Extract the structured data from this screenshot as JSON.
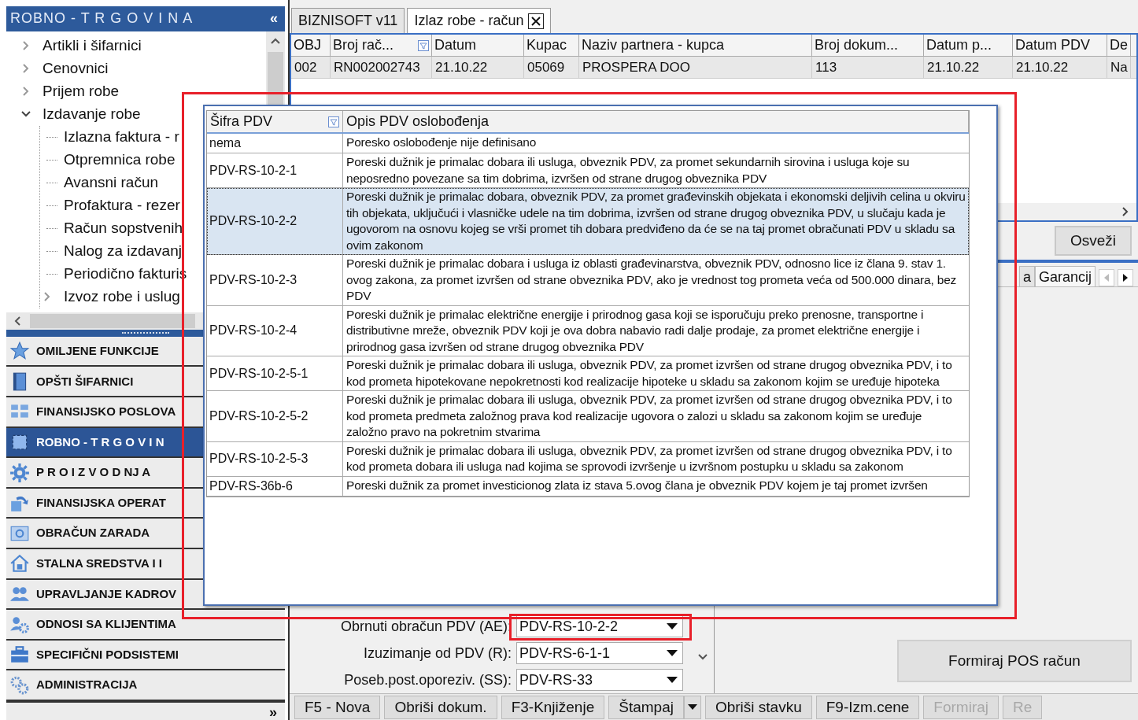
{
  "sidebar": {
    "title": "ROBNO - T R G O V I N A",
    "collapse_glyph": "«",
    "tree": [
      {
        "label": "Artikli i šifarnici",
        "expanded": false
      },
      {
        "label": "Cenovnici",
        "expanded": false
      },
      {
        "label": "Prijem robe",
        "expanded": false
      },
      {
        "label": "Izdavanje robe",
        "expanded": true,
        "children": [
          {
            "label": "Izlazna faktura - r"
          },
          {
            "label": "Otpremnica robe"
          },
          {
            "label": "Avansni račun"
          },
          {
            "label": "Profaktura - rezer"
          },
          {
            "label": "Račun sopstvenih"
          },
          {
            "label": "Nalog za izdavanj"
          },
          {
            "label": "Periodično fakturis"
          },
          {
            "label": "Izvoz robe i uslug",
            "expanded": false
          }
        ]
      }
    ],
    "nav": [
      {
        "label": "OMILJENE FUNKCIJE",
        "selected": false
      },
      {
        "label": "OPŠTI ŠIFARNICI",
        "selected": false
      },
      {
        "label": "FINANSIJSKO POSLOVA",
        "selected": false
      },
      {
        "label": "ROBNO - T R G O V I N",
        "selected": true
      },
      {
        "label": "P R O I Z V O D NJ A",
        "selected": false
      },
      {
        "label": "FINANSIJSKA OPERAT",
        "selected": false
      },
      {
        "label": "OBRAČUN ZARADA",
        "selected": false
      },
      {
        "label": "STALNA SREDSTVA I I",
        "selected": false
      },
      {
        "label": "UPRAVLJANJE KADROV",
        "selected": false
      },
      {
        "label": "ODNOSI SA KLIJENTIMA",
        "selected": false
      },
      {
        "label": "SPECIFIČNI PODSISTEMI",
        "selected": false
      },
      {
        "label": "ADMINISTRACIJA",
        "selected": false
      }
    ],
    "more_glyph": "»"
  },
  "tabs": [
    {
      "label": "BIZNISOFT v11",
      "selected": false
    },
    {
      "label": "Izlaz robe - račun",
      "selected": true
    }
  ],
  "table": {
    "columns": [
      "OBJ",
      "Broj rač...",
      "Datum",
      "Kupac",
      "Naziv partnera - kupca",
      "Broj dokum...",
      "Datum p...",
      "Datum PDV",
      "De"
    ],
    "rows": [
      {
        "cells": [
          "002",
          "RN002002743",
          "21.10.22",
          "05069",
          "PROSPERA DOO",
          "113",
          "21.10.22",
          "21.10.22",
          "Na"
        ],
        "selected": true
      }
    ]
  },
  "refresh_button": "Osveži",
  "detail_tabs": [
    {
      "label": "a",
      "selected": false
    },
    {
      "label": "Garancij",
      "selected": true
    }
  ],
  "fields": [
    {
      "label": "Obrnuti obračun PDV (AE):",
      "value": "PDV-RS-10-2-2"
    },
    {
      "label": "Izuzimanje od PDV (R):",
      "value": "PDV-RS-6-1-1"
    },
    {
      "label": "Poseb.post.oporeziv. (SS):",
      "value": "PDV-RS-33"
    }
  ],
  "pos_button": "Formiraj POS račun",
  "toolbar": [
    {
      "label": "F5 - Nova",
      "disabled": false,
      "has_menu": false
    },
    {
      "label": "Obriši dokum.",
      "disabled": false,
      "has_menu": false
    },
    {
      "label": "F3-Knjiženje",
      "disabled": false,
      "has_menu": false
    },
    {
      "label": "Štampaj",
      "disabled": false,
      "has_menu": true
    },
    {
      "label": "Obriši stavku",
      "disabled": false,
      "has_menu": false
    },
    {
      "label": "F9-Izm.cene",
      "disabled": false,
      "has_menu": false
    },
    {
      "label": "Formiraj",
      "disabled": true,
      "has_menu": false
    },
    {
      "label": "Re",
      "disabled": true,
      "has_menu": false
    }
  ],
  "popup": {
    "columns": [
      "Šifra PDV",
      "Opis PDV oslobođenja"
    ],
    "rows": [
      {
        "code": "nema",
        "description": "Poresko oslobođenje nije definisano",
        "selected": false
      },
      {
        "code": "PDV-RS-10-2-1",
        "description": "Poreski dužnik je primalac dobara ili usluga, obveznik PDV, za promet sekundarnih sirovina i usluga koje su neposredno povezane sa tim dobrima, izvršen od strane drugog obveznika PDV",
        "selected": false
      },
      {
        "code": "PDV-RS-10-2-2",
        "description": "Poreski dužnik je primalac dobara, obveznik PDV, za promet građevinskih objekata i ekonomski deljivih celina u okviru tih objekata, uključući i vlasničke udele na tim dobrima, izvršen od strane drugog obveznika PDV, u slučaju kada je ugovorom na osnovu kojeg se vrši promet tih dobara predviđeno da će se na taj promet obračunati PDV u skladu sa ovim zakonom",
        "selected": true
      },
      {
        "code": "PDV-RS-10-2-3",
        "description": "Poreski dužnik je primalac dobara i usluga iz oblasti građevinarstva, obveznik PDV, odnosno lice iz člana 9. stav 1. ovog zakona, za promet izvršen od strane obveznika PDV, ako je vrednost tog prometa veća od 500.000 dinara, bez PDV",
        "selected": false
      },
      {
        "code": "PDV-RS-10-2-4",
        "description": "Poreski dužnik je primalac električne energije i prirodnog gasa koji se isporučuju preko prenosne, transportne i distributivne mreže, obveznik PDV koji je ova dobra nabavio radi dalje prodaje, za promet električne energije i prirodnog gasa izvršen od strane drugog obveznika PDV",
        "selected": false
      },
      {
        "code": "PDV-RS-10-2-5-1",
        "description": "Poreski dužnik je primalac dobara ili usluga, obveznik PDV, za promet izvršen od strane drugog obveznika PDV, i to kod prometa hipotekovane nepokretnosti kod realizacije hipoteke u skladu sa zakonom kojim se uređuje hipoteka",
        "selected": false
      },
      {
        "code": "PDV-RS-10-2-5-2",
        "description": "Poreski dužnik je primalac dobara ili usluga, obveznik PDV, za promet izvršen od strane drugog obveznika PDV, i to kod prometa predmeta založnog prava kod realizacije ugovora o zalozi u skladu sa zakonom kojim se uređuje založno pravo na pokretnim stvarima",
        "selected": false
      },
      {
        "code": "PDV-RS-10-2-5-3",
        "description": "Poreski dužnik je primalac dobara ili usluga, obveznik PDV, za promet izvršen od strane drugog obveznika PDV, i to kod prometa dobara ili usluga nad kojima se sprovodi izvršenje u izvršnom postupku u skladu sa zakonom",
        "selected": false
      },
      {
        "code": "PDV-RS-36b-6",
        "description": "Poreski dužnik za promet investicionog zlata iz stava 5.ovog člana je obveznik PDV kojem je taj promet izvršen",
        "selected": false
      }
    ]
  }
}
